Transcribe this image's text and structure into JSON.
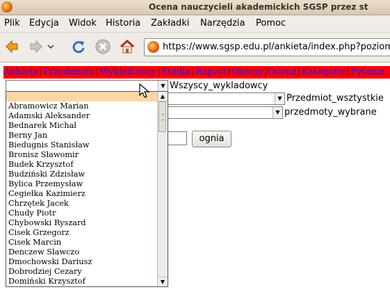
{
  "window": {
    "title": "Ocena nauczycieli akademickich SGSP przez st"
  },
  "menubar": {
    "items": [
      "Plik",
      "Edycja",
      "Widok",
      "Historia",
      "Zakładki",
      "Narzędzia",
      "Pomoc"
    ]
  },
  "navbar": {
    "url": "https://www.sgsp.edu.pl/ankieta/index.php?poziom="
  },
  "nav_menu": {
    "items": [
      "Ankieta",
      "Przedmioty",
      "Wykladowcy",
      "Studia",
      "Raport",
      "Okresy",
      "Ocena",
      "Kategorie",
      "Pytania"
    ],
    "separator": "|"
  },
  "form": {
    "lecturer_select": {
      "value": "",
      "label": "Wszyscy_wykladowcy"
    },
    "subject_select": {
      "value": "",
      "label": "Przedmiot_wsztystkie"
    },
    "subjects_selected_select": {
      "value": "",
      "label": "przedmoty_wybrane"
    },
    "submit_button": {
      "label": "ognia"
    }
  },
  "dropdown": {
    "items": [
      "",
      "Abramowicz Marian",
      "Adamski Aleksander",
      "Bednarek Michał",
      "Berny Jan",
      "Biedugnis Stanisław",
      "Bronisz Sławomir",
      "Budek Krzysztof",
      "Budziński Zdzisław",
      "Bylica Przemysław",
      "Cegiełka Kazimierz",
      "Chrzętek Jacek",
      "Chudy Piotr",
      "Chybowski Ryszard",
      "Cisek Grzegorz",
      "Cisek Marcin",
      "Denczew Sławczo",
      "Dmochowski Dariusz",
      "Dobrodziej Cezary",
      "Domiński Krzysztof"
    ],
    "highlighted_index": 0
  },
  "colors": {
    "nav_bg": "#ff0000",
    "nav_link": "#1a1aff",
    "highlight": "#fbd7a3"
  },
  "icons": [
    "firefox-icon",
    "back-arrow-icon",
    "forward-arrow-icon",
    "history-dropdown-icon",
    "reload-icon",
    "stop-icon",
    "home-icon",
    "site-favicon",
    "mouse-cursor-icon"
  ]
}
